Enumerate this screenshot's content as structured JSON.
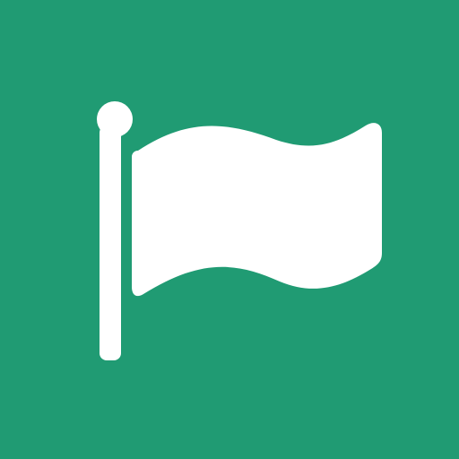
{
  "app_icon": {
    "icon": "flag-icon",
    "background_color": "#209b73",
    "foreground_color": "#ffffff"
  }
}
